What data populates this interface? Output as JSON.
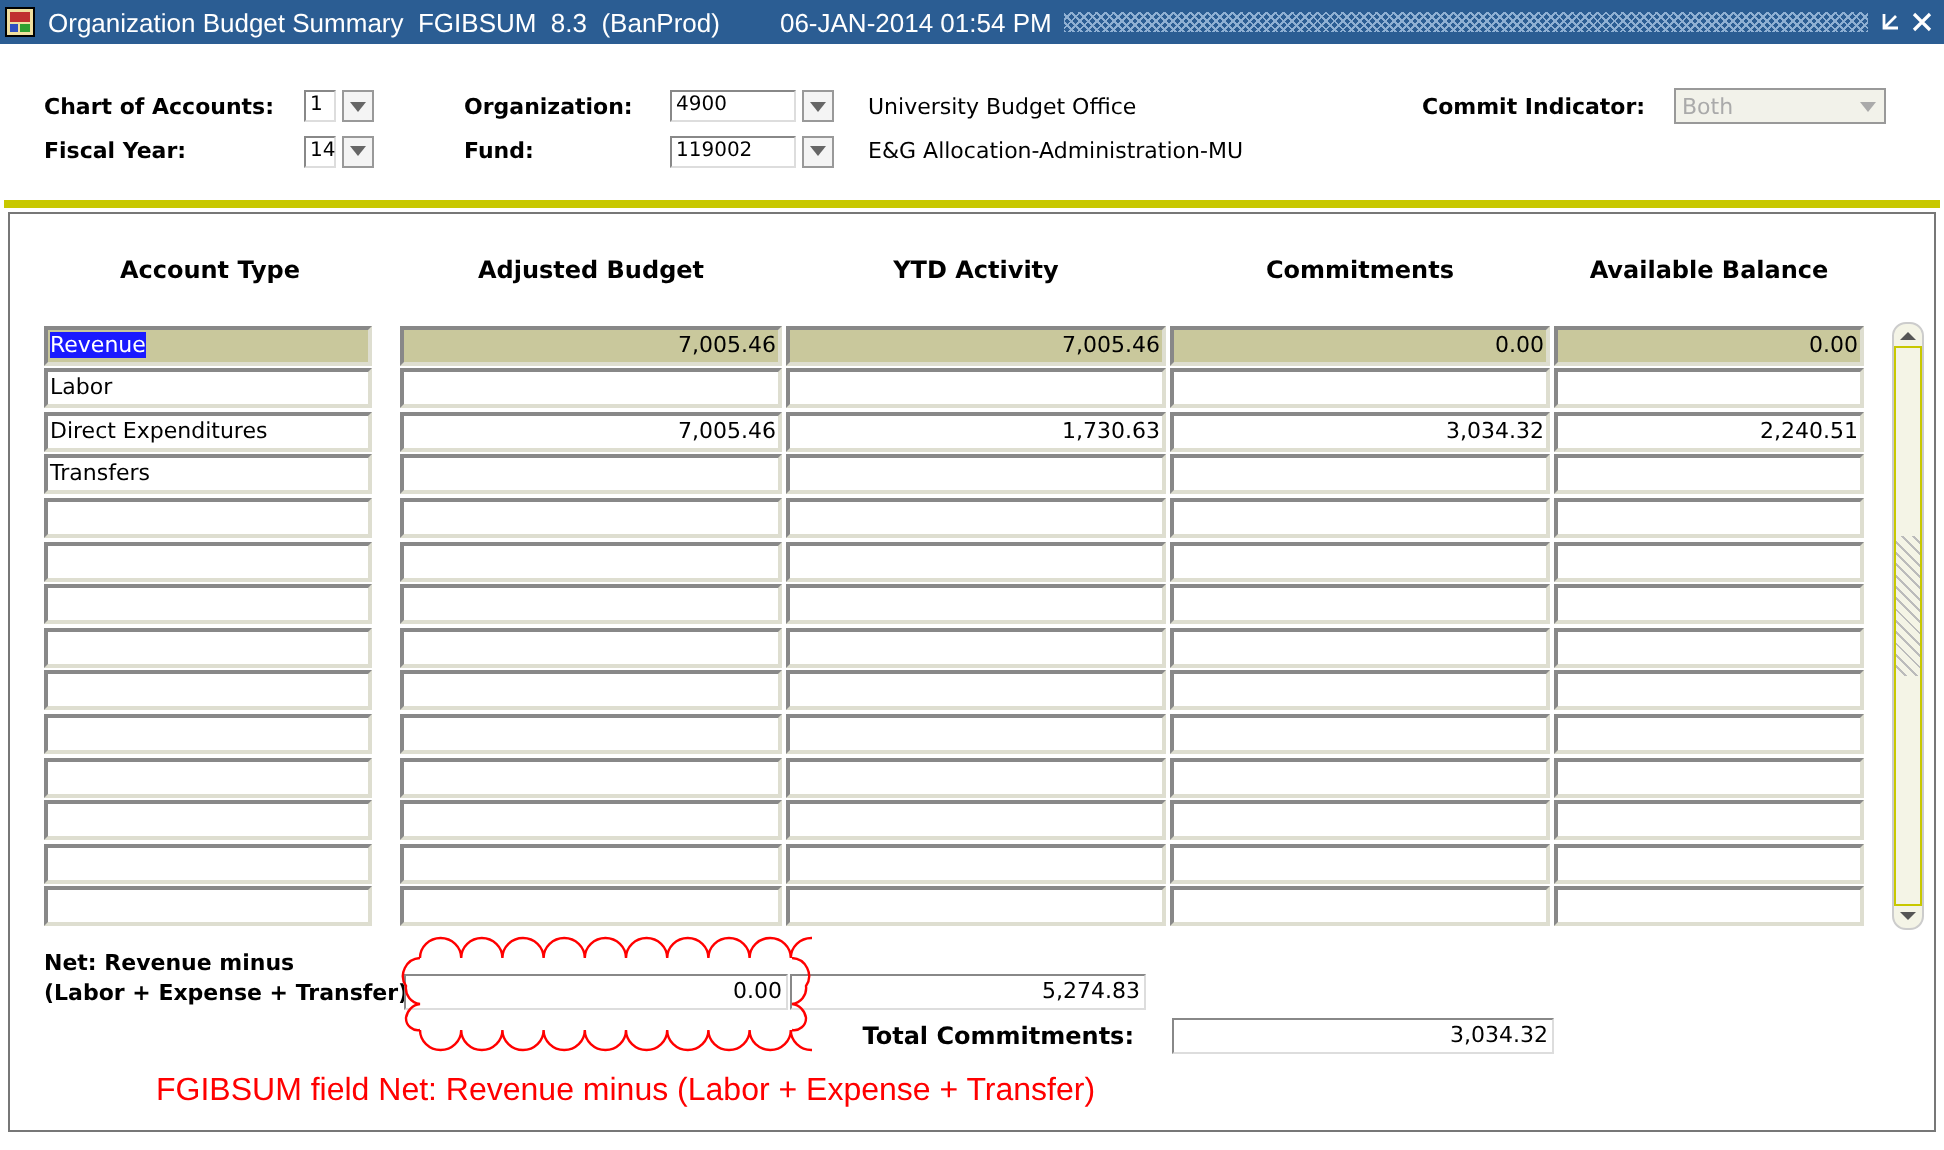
{
  "window": {
    "title": "Organization Budget Summary  FGIBSUM  8.3  (BanProd)",
    "timestamp": "06-JAN-2014 01:54 PM"
  },
  "key_block": {
    "chart_of_accounts": {
      "label": "Chart of Accounts:",
      "value": "1"
    },
    "organization": {
      "label": "Organization:",
      "value": "4900",
      "description": "University Budget Office"
    },
    "commit_indicator": {
      "label": "Commit Indicator:",
      "value": "Both",
      "disabled": true
    },
    "fiscal_year": {
      "label": "Fiscal Year:",
      "value": "14"
    },
    "fund": {
      "label": "Fund:",
      "value": "119002",
      "description": "E&G Allocation-Administration-MU"
    }
  },
  "table": {
    "columns": [
      "Account Type",
      "Adjusted Budget",
      "YTD Activity",
      "Commitments",
      "Available Balance"
    ],
    "rows": [
      {
        "selected": true,
        "cells": [
          "Revenue",
          "7,005.46",
          "7,005.46",
          "0.00",
          "0.00"
        ]
      },
      {
        "selected": false,
        "cells": [
          "Labor"
        ]
      },
      {
        "selected": false,
        "cells": [
          "Direct Expenditures",
          "7,005.46",
          "1,730.63",
          "3,034.32",
          "2,240.51"
        ]
      },
      {
        "selected": false,
        "cells": [
          "Transfers"
        ]
      },
      {
        "selected": false,
        "cells": []
      },
      {
        "selected": false,
        "cells": []
      },
      {
        "selected": false,
        "cells": []
      },
      {
        "selected": false,
        "cells": []
      },
      {
        "selected": false,
        "cells": []
      },
      {
        "selected": false,
        "cells": []
      },
      {
        "selected": false,
        "cells": []
      },
      {
        "selected": false,
        "cells": []
      },
      {
        "selected": false,
        "cells": []
      },
      {
        "selected": false,
        "cells": []
      }
    ]
  },
  "net": {
    "label_line_1": "Net:  Revenue minus",
    "label_line_2": "(Labor + Expense + Transfer)",
    "budget": "0.00",
    "ytd": "5,274.83"
  },
  "total_commitments": {
    "label": "Total Commitments:",
    "value": "3,034.32"
  },
  "annotation": "FGIBSUM field Net: Revenue minus (Labor + Expense + Transfer)"
}
